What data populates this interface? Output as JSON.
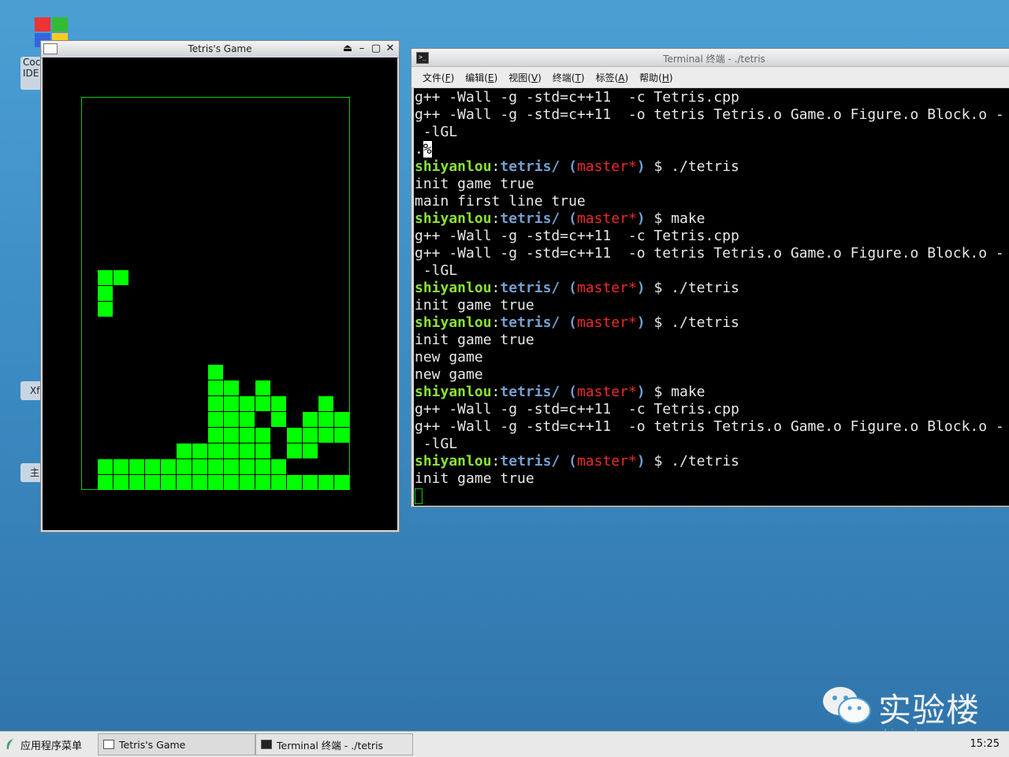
{
  "desktop": {
    "icon1_label_line1": "Coc",
    "icon1_label_line2": "IDE",
    "icon2_label": "Xf",
    "icon3_label": "主"
  },
  "tetris_window": {
    "title": "Tetris's Game",
    "buttons": [
      "⏏",
      "–",
      "▢",
      "✕"
    ],
    "board": {
      "columns": 16,
      "falling_cells": [
        [
          1,
          11
        ],
        [
          2,
          11
        ],
        [
          1,
          12
        ],
        [
          1,
          13
        ]
      ],
      "stack_rows": {
        "17": [
          8
        ],
        "18": [
          8,
          9,
          11
        ],
        "19": [
          8,
          9,
          10,
          11,
          12,
          15
        ],
        "20": [
          8,
          9,
          10,
          12,
          14,
          15,
          16
        ],
        "21": [
          8,
          9,
          10,
          11,
          13,
          14,
          15,
          16
        ],
        "22": [
          6,
          7,
          8,
          9,
          10,
          11,
          13,
          14
        ],
        "23": [
          1,
          2,
          3,
          4,
          5,
          6,
          7,
          8,
          9,
          10,
          11,
          12
        ],
        "24": [
          1,
          2,
          3,
          4,
          5,
          6,
          7,
          8,
          9,
          10,
          11,
          12,
          13,
          14,
          15,
          16
        ]
      }
    }
  },
  "terminal_window": {
    "title": "Terminal 终端 - ./tetris",
    "menu": [
      {
        "label": "文件(",
        "key": "F",
        "end": ")"
      },
      {
        "label": "编辑(",
        "key": "E",
        "end": ")"
      },
      {
        "label": "视图(",
        "key": "V",
        "end": ")"
      },
      {
        "label": "终端(",
        "key": "T",
        "end": ")"
      },
      {
        "label": "标签(",
        "key": "A",
        "end": ")"
      },
      {
        "label": "帮助(",
        "key": "H",
        "end": ")"
      }
    ],
    "prompt": {
      "user": "shiyanlou",
      "sep": ":",
      "dir": "tetris/",
      "branch_open": "(",
      "branch": "master*",
      "branch_close": ")",
      "dollar": "$"
    },
    "lines": [
      {
        "type": "out",
        "text": "g++ -Wall -g -std=c++11  -c Tetris.cpp"
      },
      {
        "type": "out",
        "text": "g++ -Wall -g -std=c++11  -o tetris Tetris.o Game.o Figure.o Block.o -"
      },
      {
        "type": "out",
        "text": " -lGL"
      },
      {
        "type": "pct",
        "text": ".",
        "mark": "%"
      },
      {
        "type": "cmd",
        "text": "./tetris"
      },
      {
        "type": "out",
        "text": "init game true"
      },
      {
        "type": "out",
        "text": "main first line true"
      },
      {
        "type": "cmd",
        "text": "make"
      },
      {
        "type": "out",
        "text": "g++ -Wall -g -std=c++11  -c Tetris.cpp"
      },
      {
        "type": "out",
        "text": "g++ -Wall -g -std=c++11  -o tetris Tetris.o Game.o Figure.o Block.o -"
      },
      {
        "type": "out",
        "text": " -lGL"
      },
      {
        "type": "cmd",
        "text": "./tetris"
      },
      {
        "type": "out",
        "text": "init game true"
      },
      {
        "type": "cmd",
        "text": "./tetris"
      },
      {
        "type": "out",
        "text": "init game true"
      },
      {
        "type": "out",
        "text": "new game"
      },
      {
        "type": "out",
        "text": "new game"
      },
      {
        "type": "cmd",
        "text": "make"
      },
      {
        "type": "out",
        "text": "g++ -Wall -g -std=c++11  -c Tetris.cpp"
      },
      {
        "type": "out",
        "text": "g++ -Wall -g -std=c++11  -o tetris Tetris.o Game.o Figure.o Block.o -"
      },
      {
        "type": "out",
        "text": " -lGL"
      },
      {
        "type": "cmd",
        "text": "./tetris"
      },
      {
        "type": "out",
        "text": "init game true"
      },
      {
        "type": "cursor",
        "text": ""
      }
    ]
  },
  "watermark": {
    "brand": "实验楼",
    "url": "shiyanlou.com"
  },
  "taskbar": {
    "start_label": "应用程序菜单",
    "tasks": [
      "Tetris's Game",
      "Terminal 终端 - ./tetris"
    ],
    "clock": "15:25"
  }
}
